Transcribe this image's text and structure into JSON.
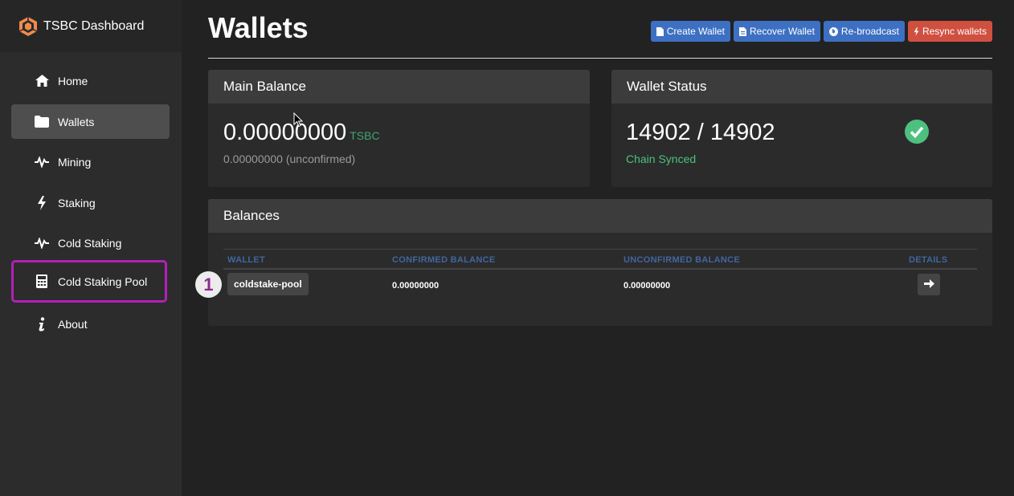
{
  "brand": {
    "name": "TSBC Dashboard",
    "logo": "cube-logo-icon"
  },
  "sidebar": {
    "items": [
      {
        "label": "Home",
        "icon": "home-icon"
      },
      {
        "label": "Wallets",
        "icon": "folder-icon",
        "active": true
      },
      {
        "label": "Mining",
        "icon": "pulse-icon"
      },
      {
        "label": "Staking",
        "icon": "bolt-icon"
      },
      {
        "label": "Cold Staking",
        "icon": "pulse-icon"
      },
      {
        "label": "Cold Staking Pool",
        "icon": "calculator-icon",
        "highlighted": true
      },
      {
        "label": "About",
        "icon": "info-icon"
      }
    ]
  },
  "page": {
    "title": "Wallets"
  },
  "actions": {
    "create": "Create Wallet",
    "recover": "Recover Wallet",
    "rebroadcast": "Re-broadcast",
    "resync": "Resync wallets"
  },
  "main_balance": {
    "title": "Main Balance",
    "amount": "0.00000000",
    "unit": "TSBC",
    "unconfirmed": "0.00000000 (unconfirmed)"
  },
  "wallet_status": {
    "title": "Wallet Status",
    "blocks": "14902 / 14902",
    "status": "Chain Synced",
    "icon": "check-circle-icon"
  },
  "balances": {
    "title": "Balances",
    "columns": [
      "WALLET",
      "CONFIRMED BALANCE",
      "UNCONFIRMED BALANCE",
      "DETAILS"
    ],
    "rows": [
      {
        "wallet": "coldstake-pool",
        "confirmed": "0.00000000",
        "unconfirmed": "0.00000000"
      }
    ]
  },
  "annotation": {
    "step": "1"
  },
  "colors": {
    "accent_blue": "#3d70c3",
    "danger_red": "#d05040",
    "success_green": "#4dc07f",
    "highlight_purple": "#b120b6"
  }
}
